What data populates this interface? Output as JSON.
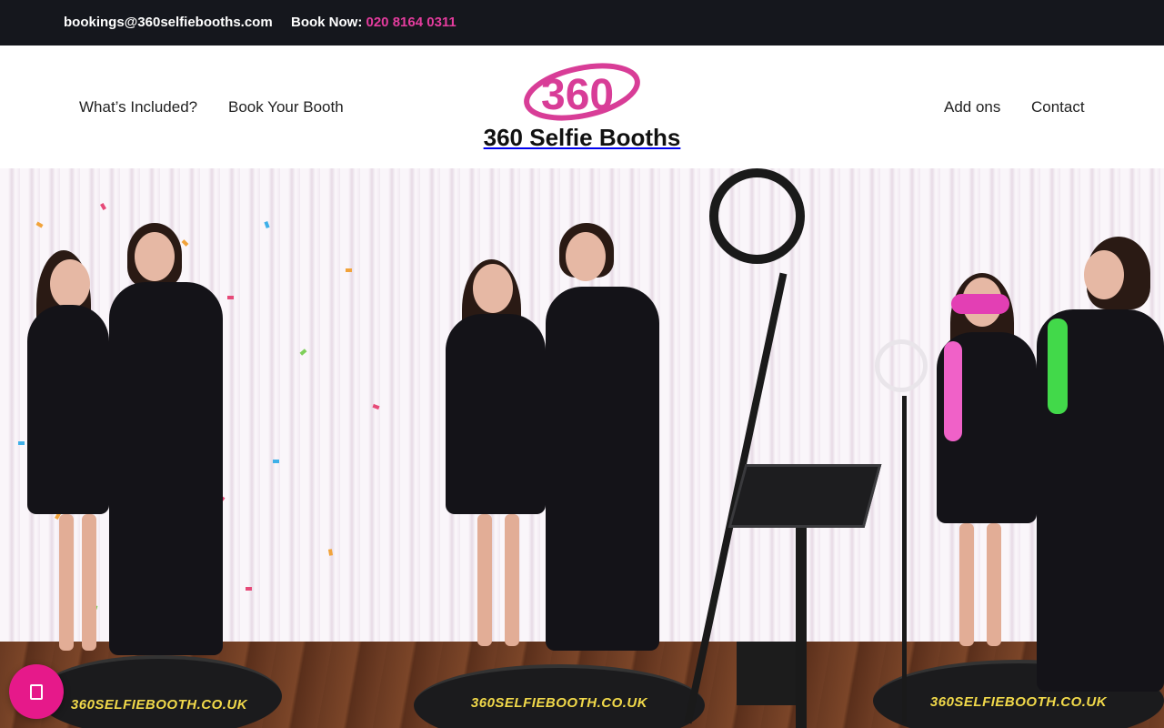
{
  "topbar": {
    "email": "bookings@360selfiebooths.com",
    "book_label": "Book Now:",
    "phone": "020 8164 0311"
  },
  "nav": {
    "left": [
      "What’s Included?",
      "Book Your Booth"
    ],
    "right": [
      "Add ons",
      "Contact"
    ]
  },
  "brand": {
    "logo_text": "360",
    "name": "360 Selfie Booths"
  },
  "hero": {
    "platform_text_left": "360SELFIEBOOTH.CO.UK",
    "platform_text_center": "360SELFIEBOOTH.CO.UK",
    "platform_text_right": "360SELFIEBOOTH.CO.UK"
  },
  "colors": {
    "topbar_bg": "#15171d",
    "accent_pink": "#e43c9e",
    "chat_button": "#e6198a"
  },
  "icons": {
    "chat_button": "chat-icon"
  }
}
